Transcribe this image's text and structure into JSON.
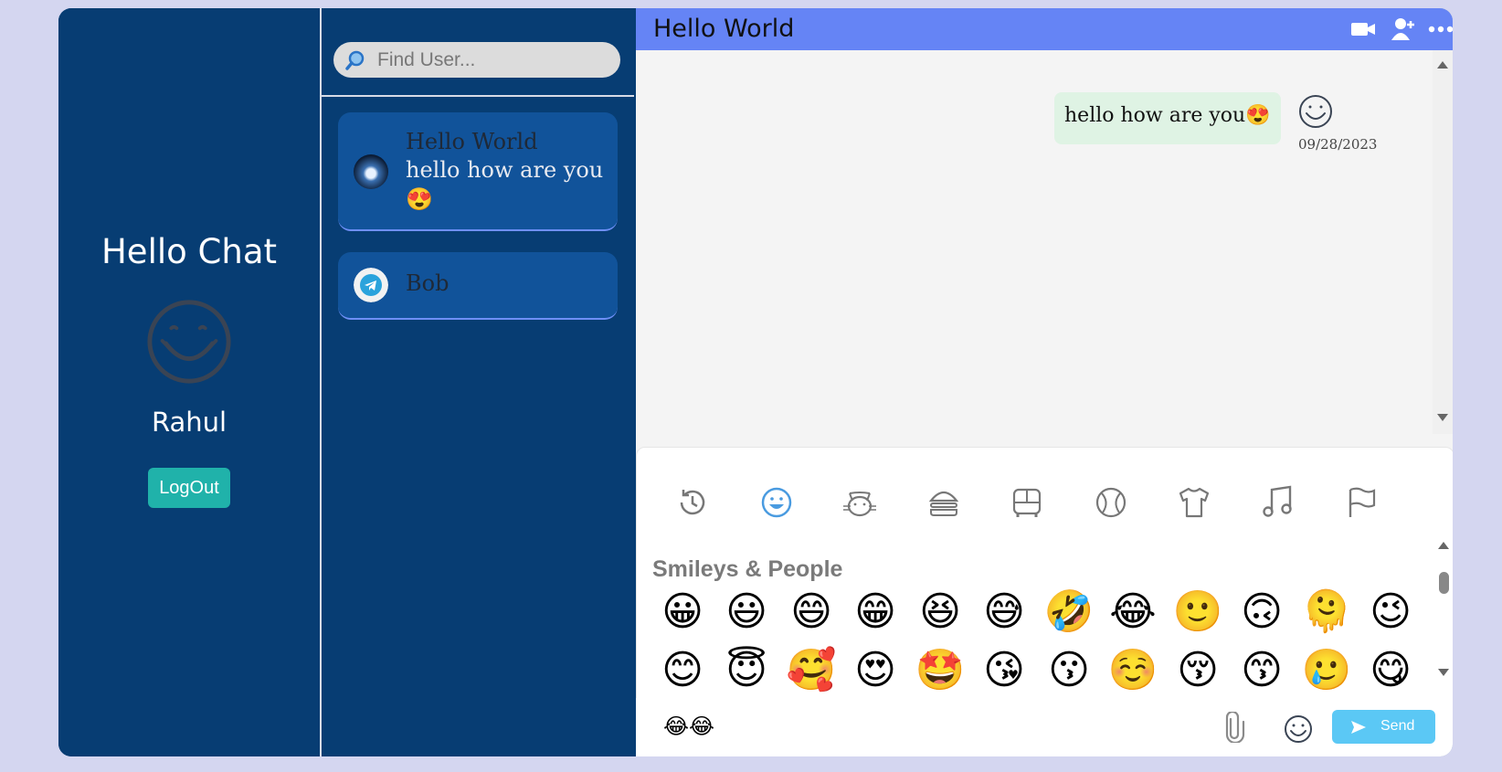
{
  "profile": {
    "app_title": "Hello Chat",
    "username": "Rahul",
    "logout_label": "LogOut"
  },
  "search": {
    "placeholder": "Find User..."
  },
  "users": [
    {
      "name": "Hello World",
      "last_message": "hello how are you 😍"
    },
    {
      "name": "Bob"
    }
  ],
  "chat": {
    "title": "Hello World",
    "header_icons": [
      "video-camera-icon",
      "add-user-icon",
      "more-options-icon"
    ],
    "messages": [
      {
        "text": "hello how are you😍",
        "date": "09/28/2023"
      }
    ]
  },
  "emoji_picker": {
    "categories": [
      "recent-icon",
      "smileys-icon",
      "animals-icon",
      "food-icon",
      "travel-icon",
      "activities-icon",
      "objects-icon",
      "symbols-icon",
      "flags-icon"
    ],
    "active_category": "smileys-icon",
    "section_title": "Smileys & People",
    "emojis": [
      "😀",
      "😃",
      "😄",
      "😁",
      "😆",
      "😅",
      "🤣",
      "😂",
      "🙂",
      "🙃",
      "🫠",
      "😉",
      "😊",
      "😇",
      "🥰",
      "😍",
      "🤩",
      "😘",
      "😗",
      "☺️",
      "😚",
      "😙",
      "🥲",
      "😋"
    ]
  },
  "composer": {
    "input_value": "😂😂",
    "icons": [
      "paperclip-icon",
      "emoji-toggle-icon"
    ],
    "send_label": "Send"
  },
  "colors": {
    "sidebar": "#073d73",
    "card": "#11539a",
    "header": "#6584f5",
    "logout": "#20b2aa",
    "send": "#5bc8f5",
    "bubble": "#dff3e4"
  }
}
